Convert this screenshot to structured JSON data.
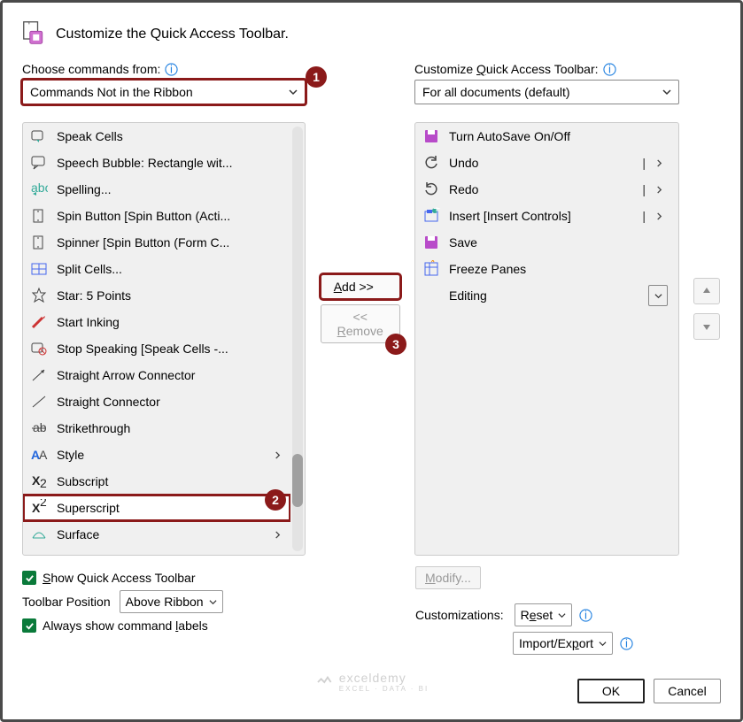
{
  "header": {
    "title": "Customize the Quick Access Toolbar."
  },
  "leftLabel": "Choose commands from:",
  "rightLabel": "Customize Quick Access Toolbar:",
  "leftSelect": "Commands Not in the Ribbon",
  "rightSelect": "For all documents (default)",
  "leftList": [
    {
      "label": "Speak Cells"
    },
    {
      "label": "Speech Bubble: Rectangle wit..."
    },
    {
      "label": "Spelling..."
    },
    {
      "label": "Spin Button [Spin Button (Acti..."
    },
    {
      "label": "Spinner [Spin Button (Form C..."
    },
    {
      "label": "Split Cells..."
    },
    {
      "label": "Star: 5 Points"
    },
    {
      "label": "Start Inking"
    },
    {
      "label": "Stop Speaking [Speak Cells -..."
    },
    {
      "label": "Straight Arrow Connector"
    },
    {
      "label": "Straight Connector"
    },
    {
      "label": "Strikethrough"
    },
    {
      "label": "Style",
      "hasSub": true
    },
    {
      "label": "Subscript"
    },
    {
      "label": "Superscript",
      "selected": true
    },
    {
      "label": "Surface",
      "hasSub": true
    }
  ],
  "rightList": [
    {
      "label": "Turn AutoSave On/Off"
    },
    {
      "label": "Undo",
      "split": true
    },
    {
      "label": "Redo",
      "split": true
    },
    {
      "label": "Insert [Insert Controls]",
      "split": true
    },
    {
      "label": "Save"
    },
    {
      "label": "Freeze Panes"
    },
    {
      "label": "Editing",
      "dropdown": true
    }
  ],
  "addBtn": "Add >>",
  "removeBtn": "<< Remove",
  "showQAT": "Show Quick Access Toolbar",
  "toolbarPosLabel": "Toolbar Position",
  "toolbarPosValue": "Above Ribbon",
  "alwaysShow": "Always show command labels",
  "modify": "Modify...",
  "customizations": "Customizations:",
  "reset": "Reset",
  "importExport": "Import/Export",
  "ok": "OK",
  "cancel": "Cancel",
  "callouts": {
    "c1": "1",
    "c2": "2",
    "c3": "3"
  },
  "watermark": {
    "main": "exceldemy",
    "sub": "EXCEL · DATA · BI"
  }
}
